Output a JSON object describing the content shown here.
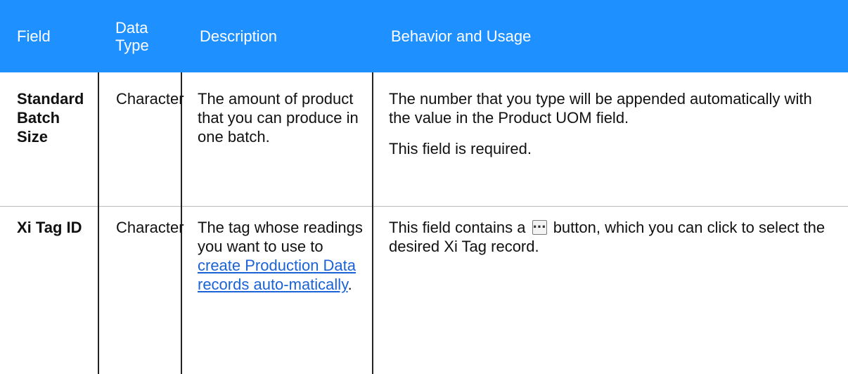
{
  "header": {
    "field": "Field",
    "data_type": "Data Type",
    "description": "Description",
    "behavior": "Behavior and Usage"
  },
  "rows": [
    {
      "field": "Standard Batch Size",
      "data_type": "Character",
      "description": "The amount of product that you can produce in one batch.",
      "behavior_p1": "The number that you type will be appended automatically with the value in the Product UOM field.",
      "behavior_p2": "This field is required."
    },
    {
      "field": "Xi Tag ID",
      "data_type": "Character",
      "description_before": "The tag whose readings you want to use to ",
      "description_link": "create Production Data records auto-matically",
      "description_after": ".",
      "behavior_before": "This field contains a",
      "behavior_icon": "ellipsis-button-icon",
      "behavior_after": "button, which you can click to select the desired Xi Tag record."
    }
  ]
}
